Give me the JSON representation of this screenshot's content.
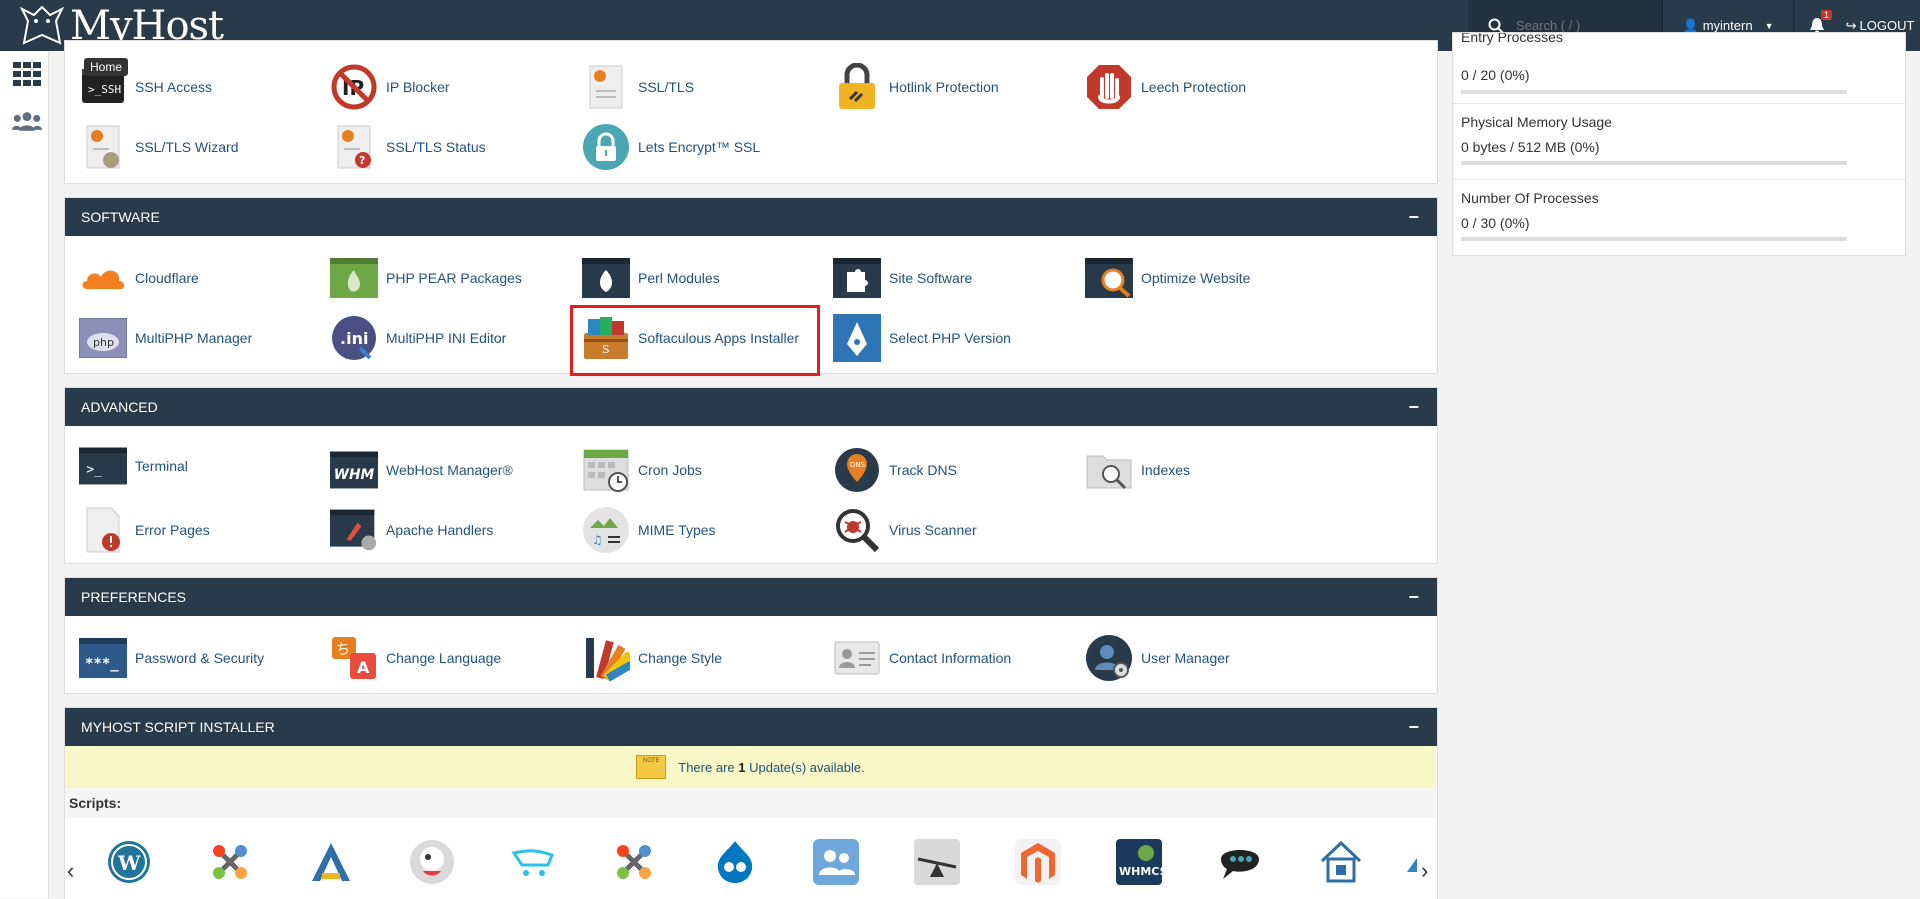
{
  "topbar": {
    "brand": "MyHost",
    "search_placeholder": "Search ( / )",
    "username": "myintern",
    "notification_count": "1",
    "logout_label": "LOGOUT"
  },
  "tooltip": "Home",
  "security": {
    "items": [
      {
        "label": "SSH Access",
        "icon": "ssh-icon"
      },
      {
        "label": "IP Blocker",
        "icon": "ip-blocker-icon"
      },
      {
        "label": "SSL/TLS",
        "icon": "certificate-icon"
      },
      {
        "label": "Hotlink Protection",
        "icon": "lock-icon"
      },
      {
        "label": "Leech Protection",
        "icon": "hand-stop-icon"
      },
      {
        "label": "SSL/TLS Wizard",
        "icon": "certificate-wizard-icon"
      },
      {
        "label": "SSL/TLS Status",
        "icon": "certificate-status-icon"
      },
      {
        "label": "Lets Encrypt™ SSL",
        "icon": "padlock-circle-icon"
      }
    ]
  },
  "software": {
    "title": "SOFTWARE",
    "collapse": "−",
    "items": [
      {
        "label": "Cloudflare",
        "icon": "cloudflare-icon"
      },
      {
        "label": "PHP PEAR Packages",
        "icon": "pear-icon"
      },
      {
        "label": "Perl Modules",
        "icon": "onion-icon"
      },
      {
        "label": "Site Software",
        "icon": "puzzle-icon"
      },
      {
        "label": "Optimize Website",
        "icon": "magnifier-icon"
      },
      {
        "label": "MultiPHP Manager",
        "icon": "php-icon"
      },
      {
        "label": "MultiPHP INI Editor",
        "icon": "ini-icon"
      },
      {
        "label": "Softaculous Apps Installer",
        "icon": "softaculous-icon"
      },
      {
        "label": "Select PHP Version",
        "icon": "php-pen-icon"
      }
    ]
  },
  "advanced": {
    "title": "ADVANCED",
    "collapse": "−",
    "items": [
      {
        "label": "Terminal",
        "icon": "terminal-icon"
      },
      {
        "label": "WebHost Manager®",
        "icon": "whm-icon"
      },
      {
        "label": "Cron Jobs",
        "icon": "calendar-clock-icon"
      },
      {
        "label": "Track DNS",
        "icon": "dns-pin-icon"
      },
      {
        "label": "Indexes",
        "icon": "folder-search-icon"
      },
      {
        "label": "Error Pages",
        "icon": "error-page-icon"
      },
      {
        "label": "Apache Handlers",
        "icon": "apache-icon"
      },
      {
        "label": "MIME Types",
        "icon": "mime-icon"
      },
      {
        "label": "Virus Scanner",
        "icon": "bug-magnifier-icon"
      }
    ]
  },
  "preferences": {
    "title": "PREFERENCES",
    "collapse": "−",
    "items": [
      {
        "label": "Password & Security",
        "icon": "password-icon"
      },
      {
        "label": "Change Language",
        "icon": "language-icon"
      },
      {
        "label": "Change Style",
        "icon": "palette-icon"
      },
      {
        "label": "Contact Information",
        "icon": "contact-card-icon"
      },
      {
        "label": "User Manager",
        "icon": "user-gear-icon"
      }
    ]
  },
  "installer": {
    "title": "MYHOST SCRIPT INSTALLER",
    "collapse": "−",
    "notice_prefix": "There are ",
    "notice_count": "1",
    "notice_suffix": " Update(s) available.",
    "scripts_label": "Scripts:",
    "prev": "‹",
    "next": "›"
  },
  "stats": [
    {
      "label": "Entry Processes",
      "value": "0 / 20   (0%)",
      "fraction": 0
    },
    {
      "label": "Physical Memory Usage",
      "value": "0 bytes / 512 MB   (0%)",
      "fraction": 0
    },
    {
      "label": "Number Of Processes",
      "value": "0 / 30   (0%)",
      "fraction": 0
    }
  ],
  "colors": {
    "topbar": "#293a4a",
    "link": "#23527c",
    "highlight": "#e02020"
  }
}
